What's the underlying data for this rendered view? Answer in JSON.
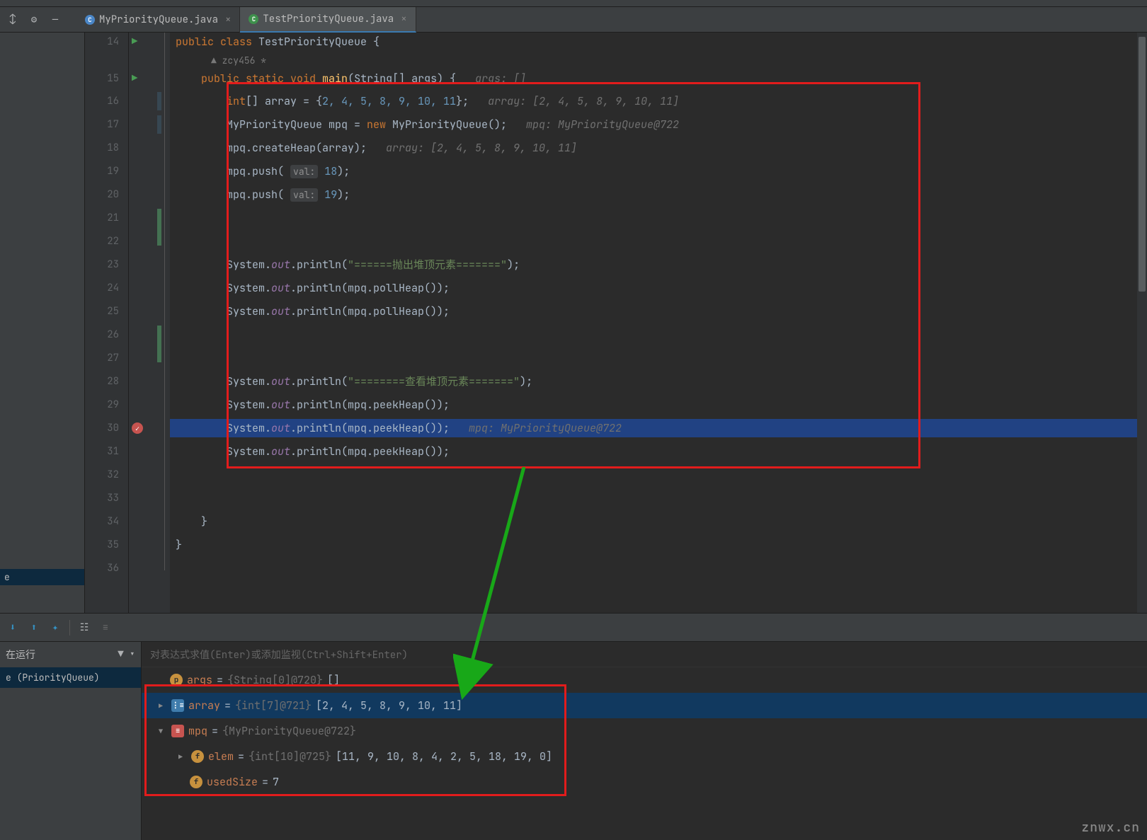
{
  "tabs": [
    {
      "name": "MyPriorityQueue.java",
      "active": false
    },
    {
      "name": "TestPriorityQueue.java",
      "active": true
    }
  ],
  "author_hint": "zcy456 *",
  "code": {
    "l14": {
      "no": "14",
      "text": "public class TestPriorityQueue {"
    },
    "l15": {
      "no": "15",
      "text": "    public static void main(String[] args) {   ",
      "hint": "args: []"
    },
    "l16": {
      "no": "16",
      "pre": "        int[] array = {",
      "nums": "2, 4, 5, 8, 9, 10, 11",
      "post": "};   ",
      "hint": "array: [2, 4, 5, 8, 9, 10, 11]"
    },
    "l17": {
      "no": "17",
      "text": "        MyPriorityQueue mpq = new MyPriorityQueue();   ",
      "hint": "mpq: MyPriorityQueue@722"
    },
    "l18": {
      "no": "18",
      "text": "        mpq.createHeap(array);   ",
      "hint": "array: [2, 4, 5, 8, 9, 10, 11]"
    },
    "l19": {
      "no": "19",
      "pre": "        mpq.push( ",
      "param": "val:",
      "num": " 18",
      "post": ");"
    },
    "l20": {
      "no": "20",
      "pre": "        mpq.push( ",
      "param": "val:",
      "num": " 19",
      "post": ");"
    },
    "l21": {
      "no": "21"
    },
    "l22": {
      "no": "22"
    },
    "l23": {
      "no": "23",
      "pre": "        System.",
      "fld": "out",
      "mid": ".println(",
      "str": "\"======抛出堆顶元素=======\"",
      "post": ");"
    },
    "l24": {
      "no": "24",
      "pre": "        System.",
      "fld": "out",
      "mid": ".println(mpq.pollHeap());"
    },
    "l25": {
      "no": "25",
      "pre": "        System.",
      "fld": "out",
      "mid": ".println(mpq.pollHeap());"
    },
    "l26": {
      "no": "26"
    },
    "l27": {
      "no": "27"
    },
    "l28": {
      "no": "28",
      "pre": "        System.",
      "fld": "out",
      "mid": ".println(",
      "str": "\"========查看堆顶元素=======\"",
      "post": ");"
    },
    "l29": {
      "no": "29",
      "pre": "        System.",
      "fld": "out",
      "mid": ".println(mpq.peekHeap());"
    },
    "l30": {
      "no": "30",
      "pre": "        System.",
      "fld": "out",
      "mid": ".println(mpq.peekHeap());   ",
      "hint": "mpq: MyPriorityQueue@722"
    },
    "l31": {
      "no": "31",
      "pre": "        System.",
      "fld": "out",
      "mid": ".println(mpq.peekHeap());"
    },
    "l32": {
      "no": "32"
    },
    "l33": {
      "no": "33"
    },
    "l34": {
      "no": "34",
      "text": "    }"
    },
    "l35": {
      "no": "35",
      "text": "}"
    },
    "l36": {
      "no": "36"
    }
  },
  "frames": {
    "header": "在运行",
    "item": "e (PriorityQueue)"
  },
  "watch_placeholder": "对表达式求值(Enter)或添加监视(Ctrl+Shift+Enter)",
  "vars": {
    "args": {
      "name": "args",
      "eq": " = ",
      "type": "{String[0]@720}",
      "val": " []"
    },
    "array": {
      "name": "array",
      "eq": " = ",
      "type": "{int[7]@721}",
      "val": " [2, 4, 5, 8, 9, 10, 11]"
    },
    "mpq": {
      "name": "mpq",
      "eq": " = ",
      "type": "{MyPriorityQueue@722}"
    },
    "elem": {
      "name": "elem",
      "eq": " = ",
      "type": "{int[10]@725}",
      "val": " [11, 9, 10, 8, 4, 2, 5, 18, 19, 0]"
    },
    "usedSize": {
      "name": "usedSize",
      "eq": " = ",
      "val": "7"
    }
  },
  "watermark": "znwx.cn"
}
